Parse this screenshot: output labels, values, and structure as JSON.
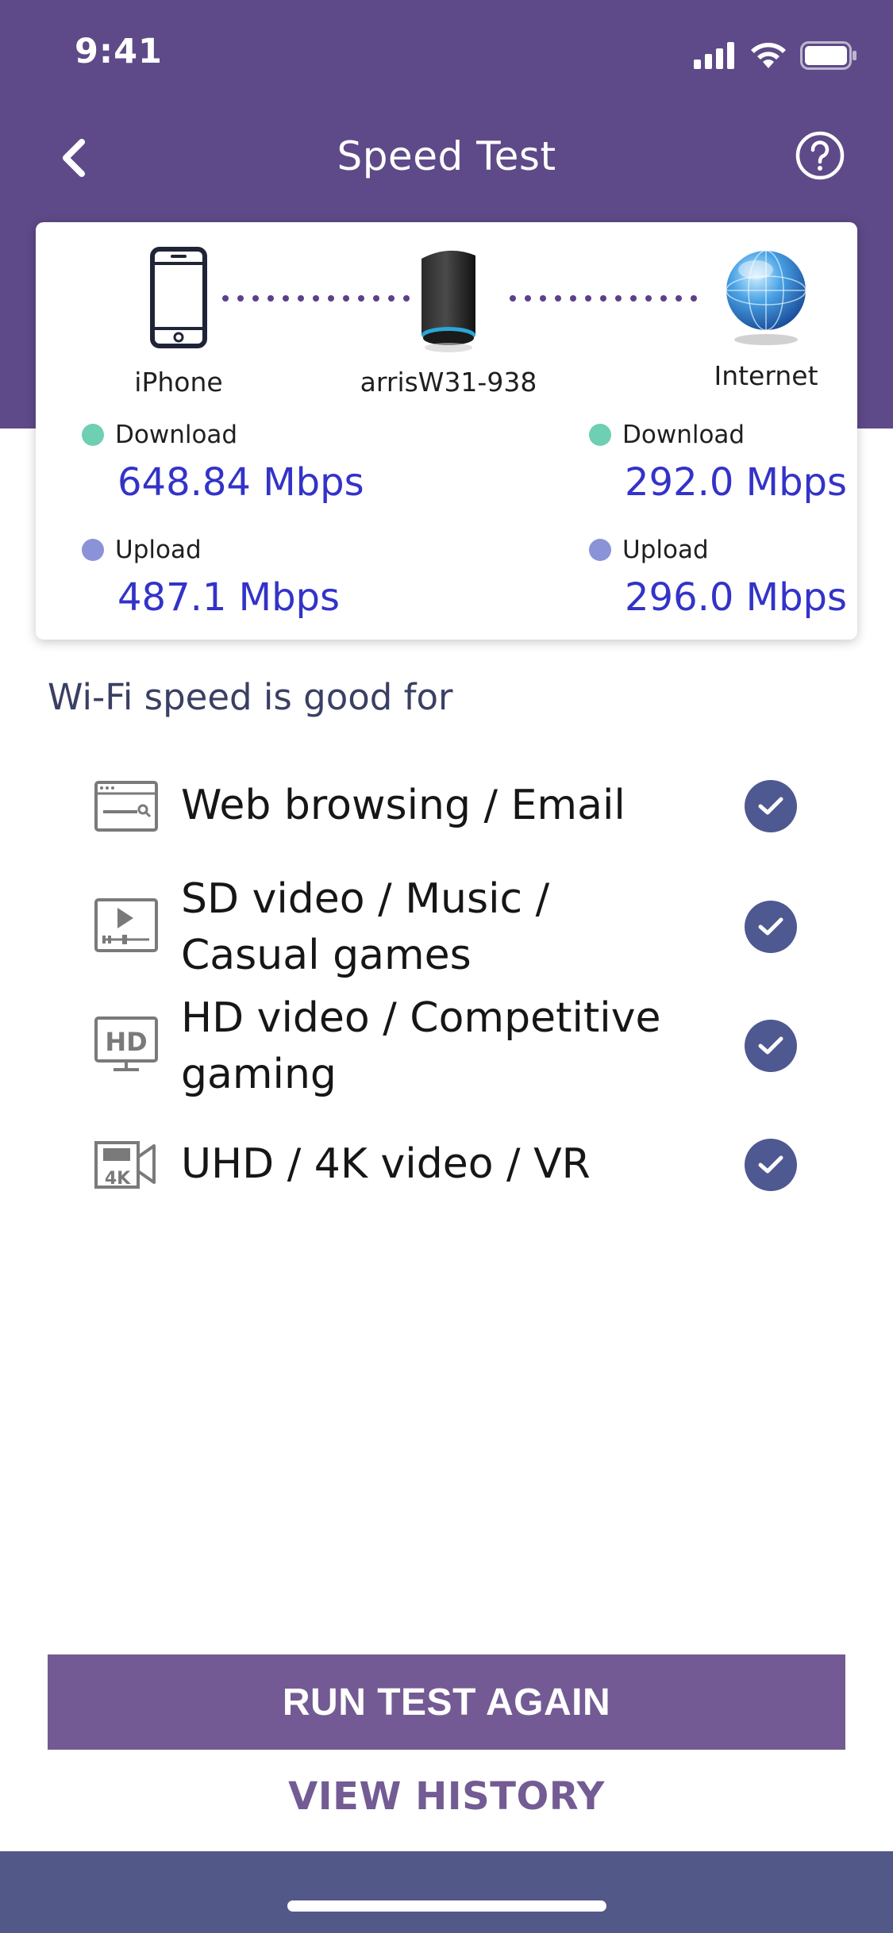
{
  "status_bar": {
    "time": "9:41"
  },
  "nav": {
    "title": "Speed Test"
  },
  "devices": {
    "phone_label": "iPhone",
    "router_label": "arrisW31-938",
    "internet_label": "Internet"
  },
  "metrics": {
    "local": {
      "download_label": "Download",
      "download_value": "648.84 Mbps",
      "upload_label": "Upload",
      "upload_value": "487.1 Mbps"
    },
    "internet": {
      "download_label": "Download",
      "download_value": "292.0 Mbps",
      "upload_label": "Upload",
      "upload_value": "296.0 Mbps"
    }
  },
  "good_for": {
    "title": "Wi-Fi speed is good for",
    "items": [
      {
        "label": "Web browsing / Email",
        "icon": "browser-window-icon"
      },
      {
        "label": "SD video / Music / Casual games",
        "icon": "video-player-icon"
      },
      {
        "label": "HD video / Competitive gaming",
        "icon": "hd-monitor-icon"
      },
      {
        "label": "UHD / 4K video / VR",
        "icon": "4k-camera-icon"
      }
    ]
  },
  "actions": {
    "run_again": "RUN TEST AGAIN",
    "view_history": "VIEW HISTORY"
  },
  "colors": {
    "header": "#5e4a88",
    "download_dot": "#6fcfb2",
    "upload_dot": "#8a92d8",
    "metric_value": "#3333c8",
    "check": "#4e5891",
    "primary_button": "#745a94",
    "bottom_bar": "#525887"
  }
}
